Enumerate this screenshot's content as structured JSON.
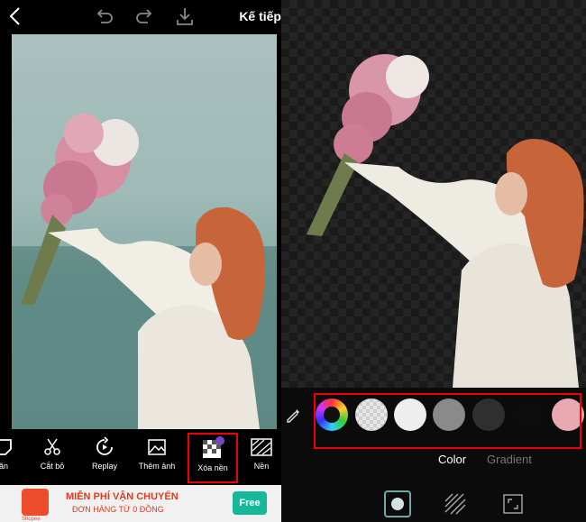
{
  "left_editor": {
    "topbar": {
      "back_icon": "chevron-left-icon",
      "undo_icon": "undo-icon",
      "redo_icon": "redo-icon",
      "download_icon": "download-icon",
      "next_label": "Kế tiếp"
    },
    "tools": [
      {
        "label": "ăn",
        "icon": "sticker-icon"
      },
      {
        "label": "Cắt bỏ",
        "icon": "scissors-icon"
      },
      {
        "label": "Replay",
        "icon": "replay-icon"
      },
      {
        "label": "Thêm ảnh",
        "icon": "add-photo-icon"
      },
      {
        "label": "Xóa nền",
        "icon": "remove-background-icon",
        "selected": true
      },
      {
        "label": "Nền",
        "icon": "background-icon"
      }
    ],
    "ad": {
      "brand": "Shopee",
      "line1": "MIỄN PHÍ VẬN CHUYỂN",
      "line2": "ĐƠN HÀNG TỪ 0 ĐỒNG",
      "badge": "Free"
    }
  },
  "right_editor": {
    "eyedropper_icon": "eyedropper-icon",
    "swatches": [
      {
        "name": "color-wheel",
        "color": "#multi"
      },
      {
        "name": "transparent",
        "color": "#cfcfcf"
      },
      {
        "name": "white",
        "color": "#eeeeee"
      },
      {
        "name": "gray",
        "color": "#8a8a8a"
      },
      {
        "name": "dark-gray",
        "color": "#2f2f2f"
      },
      {
        "name": "black",
        "color": "#0c0c0c"
      },
      {
        "name": "pink",
        "color": "#e8a9b0"
      }
    ],
    "tabs": [
      {
        "label": "Color",
        "active": true
      },
      {
        "label": "Gradient",
        "active": false
      }
    ],
    "bottom_icons": [
      "solid-fill-icon",
      "pattern-icon",
      "resize-icon"
    ]
  },
  "colors": {
    "highlight": "#e00000",
    "active_tab": "#ffffff",
    "inactive_tab": "#777777"
  }
}
